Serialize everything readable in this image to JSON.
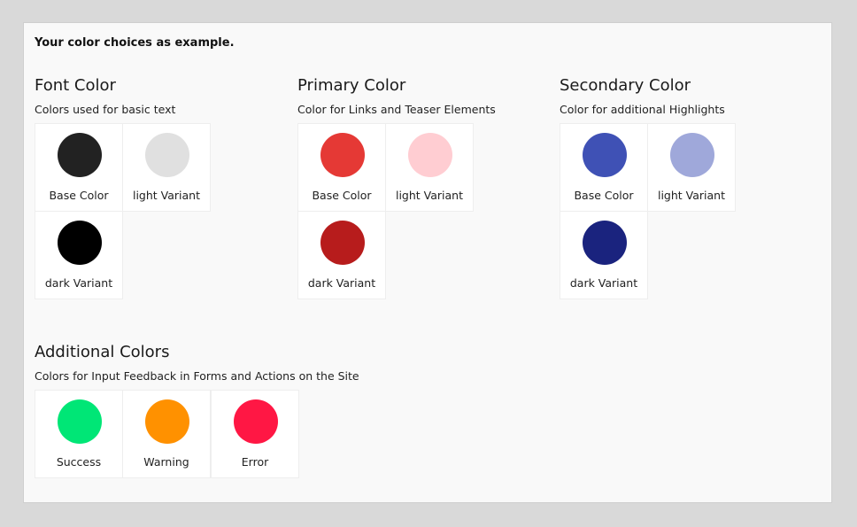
{
  "intro": "Your color choices as example.",
  "font_color": {
    "title": "Font Color",
    "description": "Colors used for basic text",
    "swatches": [
      {
        "label": "Base Color",
        "color": "#222222"
      },
      {
        "label": "light Variant",
        "color": "#e0e0e0"
      },
      {
        "label": "dark Variant",
        "color": "#000000"
      }
    ]
  },
  "primary_color": {
    "title": "Primary Color",
    "description": "Color for Links and Teaser Elements",
    "swatches": [
      {
        "label": "Base Color",
        "color": "#e53935"
      },
      {
        "label": "light Variant",
        "color": "#ffcdd2"
      },
      {
        "label": "dark Variant",
        "color": "#b71c1c"
      }
    ]
  },
  "secondary_color": {
    "title": "Secondary Color",
    "description": "Color for additional Highlights",
    "swatches": [
      {
        "label": "Base Color",
        "color": "#3f51b5"
      },
      {
        "label": "light Variant",
        "color": "#9fa8da"
      },
      {
        "label": "dark Variant",
        "color": "#1a237e"
      }
    ]
  },
  "additional_colors": {
    "title": "Additional Colors",
    "description": "Colors for Input Feedback in Forms and Actions on the Site",
    "swatches": [
      {
        "label": "Success",
        "color": "#00e676"
      },
      {
        "label": "Warning",
        "color": "#ff9100"
      },
      {
        "label": "Error",
        "color": "#ff1744"
      }
    ]
  }
}
